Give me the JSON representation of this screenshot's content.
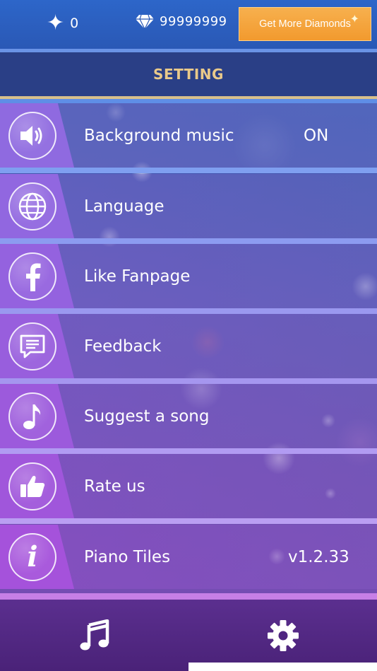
{
  "topbar": {
    "stars_count": "0",
    "diamonds_count": "99999999",
    "get_more_label": "Get More Diamonds"
  },
  "header": {
    "title": "SETTING"
  },
  "settings": {
    "items": [
      {
        "label": "Background music",
        "value": "ON",
        "icon": "speaker-icon"
      },
      {
        "label": "Language",
        "value": "",
        "icon": "globe-icon"
      },
      {
        "label": "Like Fanpage",
        "value": "",
        "icon": "facebook-icon"
      },
      {
        "label": "Feedback",
        "value": "",
        "icon": "chat-bubble-icon"
      },
      {
        "label": "Suggest a song",
        "value": "",
        "icon": "music-note-icon"
      },
      {
        "label": "Rate us",
        "value": "",
        "icon": "thumbs-up-icon"
      },
      {
        "label": "Piano Tiles",
        "value": "v1.2.33",
        "icon": "info-icon"
      }
    ]
  },
  "bottom_nav": {
    "items": [
      {
        "name": "songs",
        "icon": "music-notes-icon",
        "active": false
      },
      {
        "name": "settings",
        "icon": "gear-icon",
        "active": true
      }
    ]
  },
  "colors": {
    "accent_gold": "#e9c98a",
    "button_orange": "#f29a2e",
    "title_bar": "#2a3f86",
    "bottom_nav": "#4a2278"
  }
}
